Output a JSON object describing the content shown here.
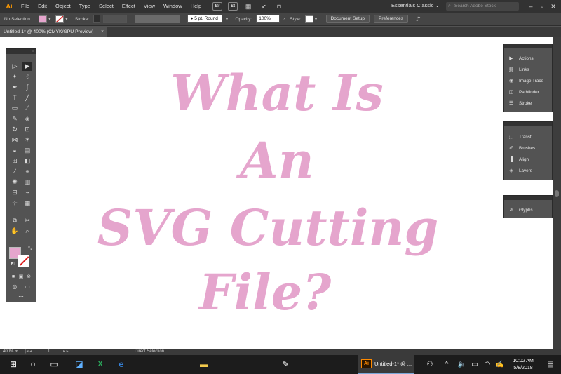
{
  "menu": {
    "logo": "Ai",
    "items": [
      "File",
      "Edit",
      "Object",
      "Type",
      "Select",
      "Effect",
      "View",
      "Window",
      "Help"
    ],
    "bridge_label": "Br",
    "stock_label": "St",
    "workspace": "Essentials Classic",
    "search_placeholder": "Search Adobe Stock"
  },
  "control": {
    "selection_label": "No Selection",
    "fill_color": "#e5a5cd",
    "stroke_label": "Stroke:",
    "brush_value": "5 pt. Round",
    "opacity_label": "Opacity:",
    "opacity_value": "100%",
    "style_label": "Style:",
    "document_setup": "Document Setup",
    "preferences": "Preferences"
  },
  "document": {
    "tab_title": "Untitled-1* @ 400% (CMYK/GPU Preview)",
    "tab_close": "×"
  },
  "artwork": {
    "lines": [
      "What Is",
      "An",
      "SVG Cutting",
      "File?"
    ],
    "color": "#e5a5cd"
  },
  "right_panels": {
    "group1": [
      "Actions",
      "Links",
      "Image Trace",
      "Pathfinder",
      "Stroke"
    ],
    "group2": [
      "Transf...",
      "Brushes",
      "Align",
      "Layers"
    ],
    "group3": [
      "Glyphs"
    ]
  },
  "status": {
    "zoom": "400%",
    "artboard": "1",
    "tool": "Direct Selection"
  },
  "taskbar": {
    "active_app_logo": "Ai",
    "active_app_label": "Untitled-1* @ ...",
    "time": "10:02 AM",
    "date": "5/8/2018"
  }
}
